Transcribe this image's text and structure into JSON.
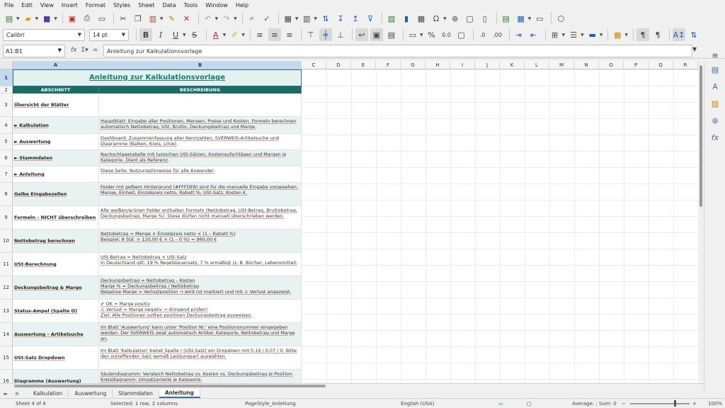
{
  "menu": [
    "File",
    "Edit",
    "View",
    "Insert",
    "Format",
    "Styles",
    "Sheet",
    "Data",
    "Tools",
    "Window",
    "Help"
  ],
  "format": {
    "font_name": "Calibri",
    "font_size": "14 pt"
  },
  "formula_bar": {
    "name_box": "A1:B1",
    "content": "Anleitung zur Kalkulationsvorlage"
  },
  "columns": [
    "A",
    "B",
    "C",
    "D",
    "E",
    "F",
    "G",
    "H",
    "I",
    "J",
    "K",
    "L",
    "M",
    "N",
    "O",
    "P",
    "Q",
    "R"
  ],
  "sheet": {
    "title": "Anleitung zur Kalkulationsvorlage",
    "header_a": "ABSCHNITT",
    "header_b": "BESCHREIBUNG",
    "rows": [
      {
        "num": "3",
        "a": "Übersicht der Blätter",
        "b": ""
      },
      {
        "num": "4",
        "a": "► Kalkulation",
        "b": "Hauptblatt: Eingabe aller Positionen, Mengen, Preise und Kosten. Formeln berechnen automatisch Nettobetrag, USt, Brutto, Deckungsbeitrag und Marge."
      },
      {
        "num": "5",
        "a": "► Auswertung",
        "b": "Dashboard: Zusammenfassung aller Kennzahlen, SVERWEIS-Artikelsuche und Diagramme (Balken, Kreis, Linie)."
      },
      {
        "num": "6",
        "a": "► Stammdaten",
        "b": "Nachschlagetabelle mit typischen USt-Sätzen, Kostenaufschlägen und Margen je Kategorie. Dient als Referenz."
      },
      {
        "num": "7",
        "a": "► Anleitung",
        "b": "Diese Seite. Nutzungshinweise für alle Anwender."
      },
      {
        "num": "8",
        "a": "Gelbe Eingabezellen",
        "b": "Felder mit gelbem Hintergrund (#FFFDE8) sind für die manuelle Eingabe vorgesehen: Menge, Einheit, Einzelpreis netto, Rabatt %, USt-Satz, Kosten €."
      },
      {
        "num": "9",
        "a": "Formeln – NICHT überschreiben",
        "b": "Alle weißen/grünen Felder enthalten Formeln (Nettobetrag, USt-Betrag, Bruttobetrag, Deckungsbeitrag, Marge %). Diese dürfen nicht manuell überschrieben werden."
      },
      {
        "num": "10",
        "a": "Nettobetrag berechnen",
        "b": "Nettobetrag = Menge × Einzelpreis netto × (1 – Rabatt %)\nBeispiel: 8 Std. × 120,00 € × (1 – 0 %) = 960,00 €"
      },
      {
        "num": "11",
        "a": "USt-Berechnung",
        "b": "USt-Betrag = Nettobetrag × USt-Satz\nIn Deutschland gilt: 19 % Regelsteuersatz, 7 % ermäßigt (z. B. Bücher, Lebensmittel)."
      },
      {
        "num": "12",
        "a": "Deckungsbeitrag & Marge",
        "b": "Deckungsbeitrag = Nettobetrag – Kosten\nMarge % = Deckungsbeitrag / Nettobetrag\nNegative Marge = Verlustposition → wird rot markiert und mit ⚠ Verlust angezeigt."
      },
      {
        "num": "13",
        "a": "Status-Ampel (Spalte O)",
        "b": "✔ OK = Marge positiv\n⚠ Verlust = Marge negativ → dringend prüfen!\nZiel: Alle Positionen sollten positiven Deckungsbeitrag ausweisen."
      },
      {
        "num": "14",
        "a": "Auswertung – Artikelsuche",
        "b": "Im Blatt 'Auswertung' kann unter 'Position Nr.' eine Positionsnummer eingegeben werden. Der SVERWEIS zeigt automatisch Artikel, Kategorie, Nettobetrag und Marge an."
      },
      {
        "num": "15",
        "a": "USt-Satz Dropdown",
        "b": "Im Blatt 'Kalkulation' bietet Spalte I (USt-Satz) ein Dropdown mit 0,19 / 0,07 / 0. Bitte den zutreffenden Satz gemäß Leistungsart auswählen."
      },
      {
        "num": "16",
        "a": "Diagramme (Auswertung)",
        "b": "Säulendiagramm: Vergleich Nettobetrag vs. Kosten vs. Deckungsbeitrag je Position.\nKreisdiagramm: Umsatzanteile je Kategorie."
      }
    ]
  },
  "tabs": [
    "Kalkulation",
    "Auswertung",
    "Stammdaten",
    "Anleitung"
  ],
  "active_tab": "Anleitung",
  "status": {
    "sheet": "Sheet 4 of 4",
    "selection": "Selected: 1 row, 2 columns",
    "page_style": "PageStyle_Anleitung",
    "language": "English (USA)",
    "summary": "Average: ; Sum: 0",
    "zoom": "100%"
  },
  "icons": {
    "toolbar1": [
      "new-icon",
      "open-icon",
      "save-icon",
      "export-pdf-icon",
      "print-icon",
      "print-preview-icon",
      "cut-icon",
      "copy-icon",
      "paste-icon",
      "clone-format-icon",
      "clear-format-icon",
      "undo-icon",
      "redo-icon",
      "find-replace-icon",
      "spelling-icon",
      "row-icon",
      "column-icon",
      "sort-icon",
      "sort-asc-icon",
      "sort-desc-icon",
      "autofilter-icon",
      "image-icon",
      "chart-icon",
      "pivot-icon",
      "special-char-icon",
      "hyperlink-icon",
      "comment-icon",
      "headers-footers-icon",
      "define-print-area-icon",
      "freeze-icon",
      "split-window-icon",
      "show-draw-icon"
    ],
    "sidebar": [
      "properties-icon",
      "styles-icon",
      "gallery-icon",
      "navigator-icon",
      "functions-icon"
    ]
  }
}
